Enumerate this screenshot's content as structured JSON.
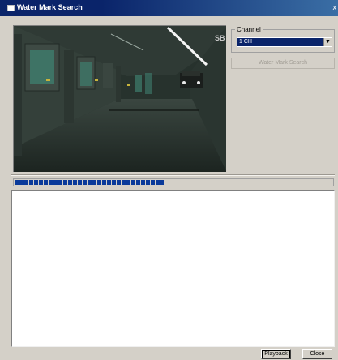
{
  "window": {
    "title": "Water Mark Search",
    "close_glyph": "x"
  },
  "channel": {
    "legend": "Channel",
    "selected": "1 CH",
    "dropdown_icon": "chevron-down-icon"
  },
  "buttons": {
    "water_mark_search": "Water Mark Search",
    "playback": "Playback",
    "close": "Close"
  },
  "video": {
    "overlay_text": "SB"
  },
  "progress": {
    "fraction": 0.47
  },
  "colors": {
    "titlebar": "#0a246a",
    "progress": "#0a3a9a",
    "selection": "#0a246a"
  }
}
